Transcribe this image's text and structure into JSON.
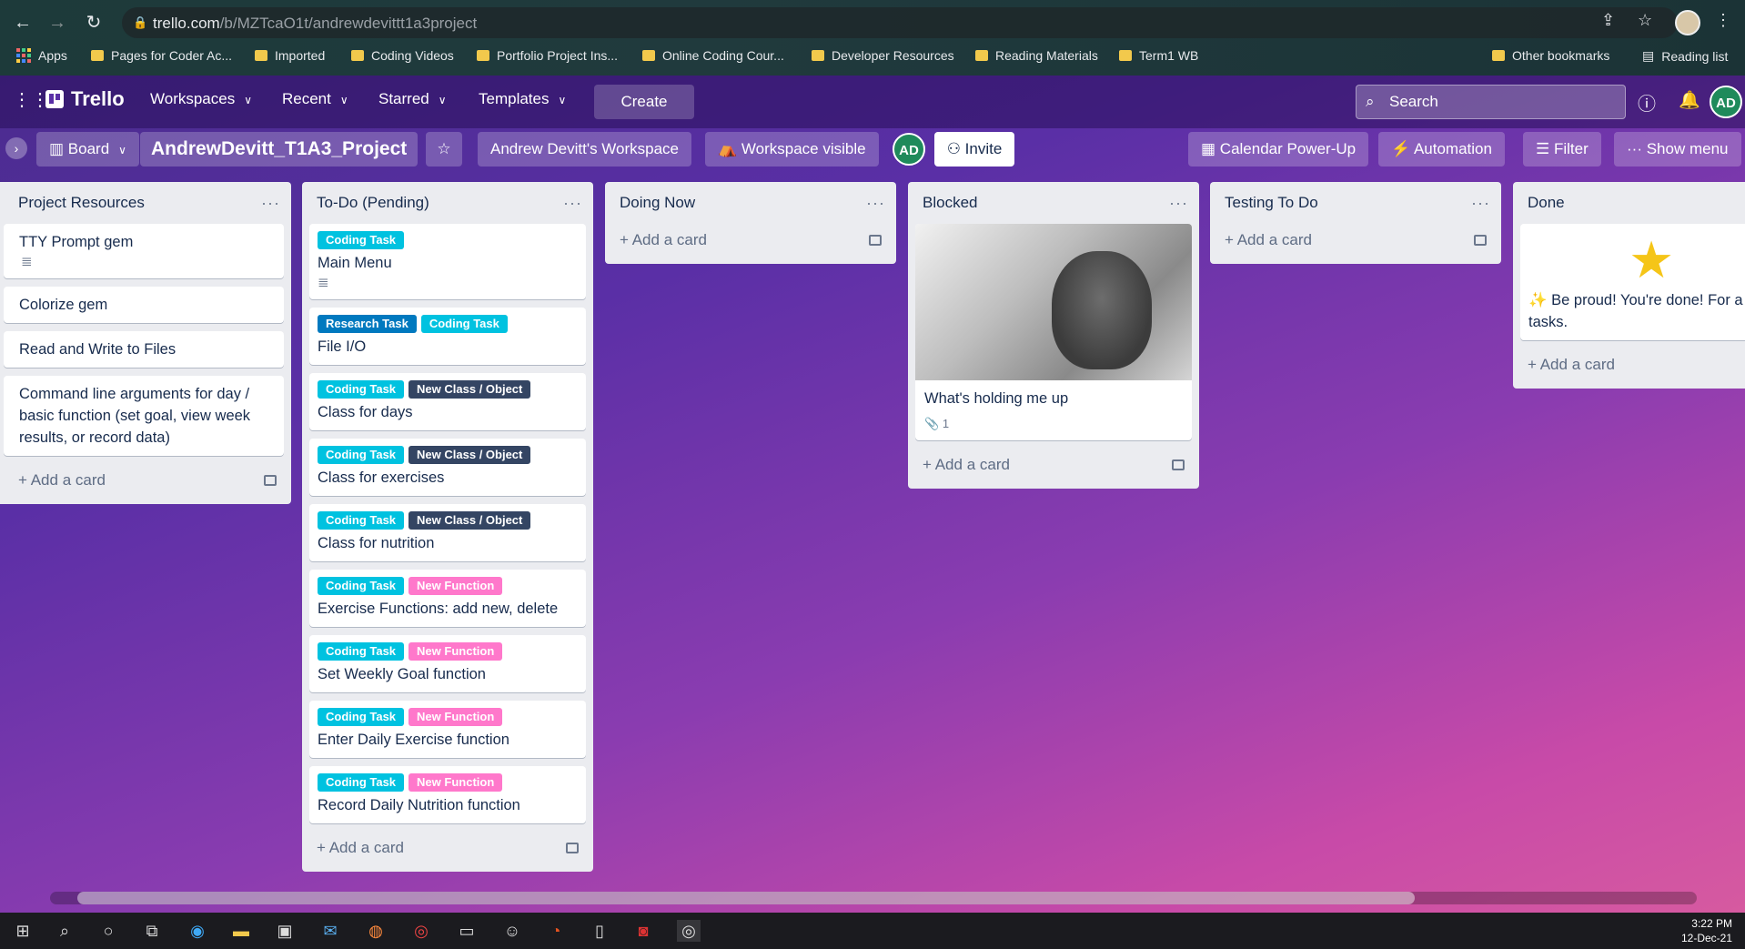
{
  "browser": {
    "url_host": "trello.com",
    "url_path": "/b/MZTcaO1t/andrewdevittt1a3project",
    "bookmarks": [
      "Apps",
      "Pages for Coder Ac...",
      "Imported",
      "Coding Videos",
      "Portfolio Project Ins...",
      "Online Coding Cour...",
      "Developer Resources",
      "Reading Materials",
      "Term1 WB"
    ],
    "other_bookmarks": "Other bookmarks",
    "reading_list": "Reading list"
  },
  "nav": {
    "logo": "Trello",
    "workspaces": "Workspaces",
    "recent": "Recent",
    "starred": "Starred",
    "templates": "Templates",
    "create": "Create",
    "search_placeholder": "Search",
    "avatar": "AD"
  },
  "board": {
    "view": "Board",
    "title": "AndrewDevitt_T1A3_Project",
    "workspace": "Andrew Devitt's Workspace",
    "visibility": "Workspace visible",
    "member": "AD",
    "invite": "Invite",
    "calendar": "Calendar Power-Up",
    "automation": "Automation",
    "filter": "Filter",
    "show_menu": "Show menu"
  },
  "add_card": "Add a card",
  "lists": [
    {
      "title": "Project Resources",
      "cards": [
        {
          "text": "TTY Prompt gem"
        },
        {
          "text": "Colorize gem"
        },
        {
          "text": "Read and Write to Files"
        },
        {
          "text": "Command line arguments for day / basic function (set goal, view week results, or record data)"
        }
      ]
    },
    {
      "title": "To-Do (Pending)",
      "cards": [
        {
          "labels": [
            "Coding Task"
          ],
          "text": "Main Menu"
        },
        {
          "labels": [
            "Research Task",
            "Coding Task"
          ],
          "text": "File I/O"
        },
        {
          "labels": [
            "Coding Task",
            "New Class / Object"
          ],
          "text": "Class for days"
        },
        {
          "labels": [
            "Coding Task",
            "New Class / Object"
          ],
          "text": "Class for exercises"
        },
        {
          "labels": [
            "Coding Task",
            "New Class / Object"
          ],
          "text": "Class for nutrition"
        },
        {
          "labels": [
            "Coding Task",
            "New Function"
          ],
          "text": "Exercise Functions: add new, delete"
        },
        {
          "labels": [
            "Coding Task",
            "New Function"
          ],
          "text": "Set Weekly Goal function"
        },
        {
          "labels": [
            "Coding Task",
            "New Function"
          ],
          "text": "Enter Daily Exercise function"
        },
        {
          "labels": [
            "Coding Task",
            "New Function"
          ],
          "text": "Record Daily Nutrition function"
        }
      ]
    },
    {
      "title": "Doing Now",
      "cards": []
    },
    {
      "title": "Blocked",
      "cards": [
        {
          "text": "What's holding me up",
          "attachments": "1"
        }
      ]
    },
    {
      "title": "Testing To Do",
      "cards": []
    },
    {
      "title": "Done",
      "cards": [
        {
          "text": "Be proud! You're done! For a finished tasks."
        }
      ]
    }
  ],
  "taskbar": {
    "time": "3:22 PM",
    "date": "12-Dec-21"
  }
}
